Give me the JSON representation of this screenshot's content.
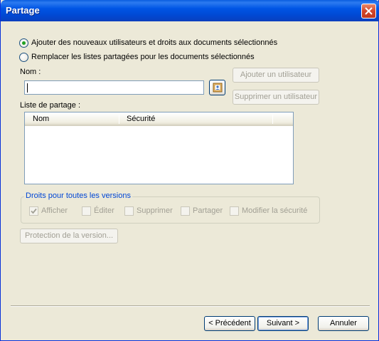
{
  "window": {
    "title": "Partage"
  },
  "options": {
    "add_label": "Ajouter des nouveaux utilisateurs et droits aux documents sélectionnés",
    "replace_label": "Remplacer les listes partagées pour les documents sélectionnés",
    "selected": "add"
  },
  "name_field": {
    "label": "Nom :",
    "value": ""
  },
  "buttons": {
    "add_user": "Ajouter un utilisateur",
    "remove_user": "Supprimer un utilisateur",
    "version_protection": "Protection de la version...",
    "previous": "< Précédent",
    "next": "Suivant >",
    "cancel": "Annuler"
  },
  "share_list": {
    "label": "Liste de partage :",
    "columns": [
      "Nom",
      "Sécurité"
    ],
    "rows": []
  },
  "rights": {
    "group_label": "Droits pour toutes les versions",
    "items": [
      {
        "label": "Afficher",
        "checked": true
      },
      {
        "label": "Éditer",
        "checked": false
      },
      {
        "label": "Supprimer",
        "checked": false
      },
      {
        "label": "Partager",
        "checked": false
      },
      {
        "label": "Modifier la sécurité",
        "checked": false
      }
    ]
  },
  "colors": {
    "title_bar": "#0055e5",
    "face": "#ece9d8",
    "group_label": "#0046d5"
  }
}
